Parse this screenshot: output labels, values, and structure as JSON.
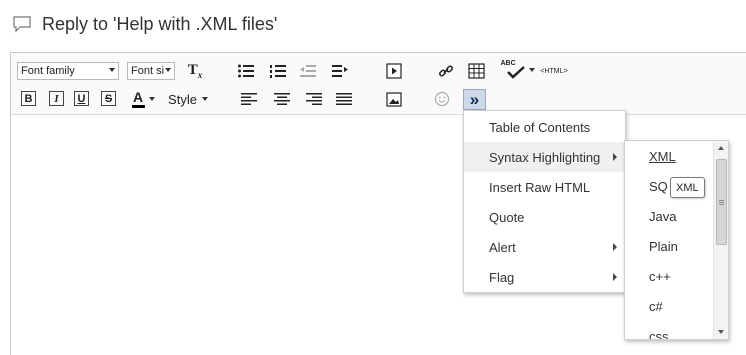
{
  "reply": {
    "title": "Reply to 'Help with .XML files'"
  },
  "toolbar": {
    "font_family": "Font family",
    "font_size": "Font si",
    "clear_format": "T",
    "clear_format_sub": "x",
    "spell_abc": "ABC",
    "html_label": "<HTML>",
    "bold": "B",
    "italic": "I",
    "underline": "U",
    "strike": "S",
    "text_color": "A",
    "style": "Style",
    "more": "»"
  },
  "menu": {
    "items": [
      {
        "label": "Table of Contents",
        "has_submenu": false
      },
      {
        "label": "Syntax Highlighting",
        "has_submenu": true
      },
      {
        "label": "Insert Raw HTML",
        "has_submenu": false
      },
      {
        "label": "Quote",
        "has_submenu": false
      },
      {
        "label": "Alert",
        "has_submenu": true
      },
      {
        "label": "Flag",
        "has_submenu": true
      }
    ]
  },
  "submenu": {
    "items": [
      "XML",
      "SQ",
      "Java",
      "Plain",
      "c++",
      "c#",
      "css"
    ]
  },
  "tooltip": {
    "text": "XML"
  },
  "colors": {
    "accent": "#1a5fb4",
    "more_button_bg": "#cfd8e8",
    "menu_hover": "#f0f0f0",
    "text_color_bar": "#000000"
  }
}
